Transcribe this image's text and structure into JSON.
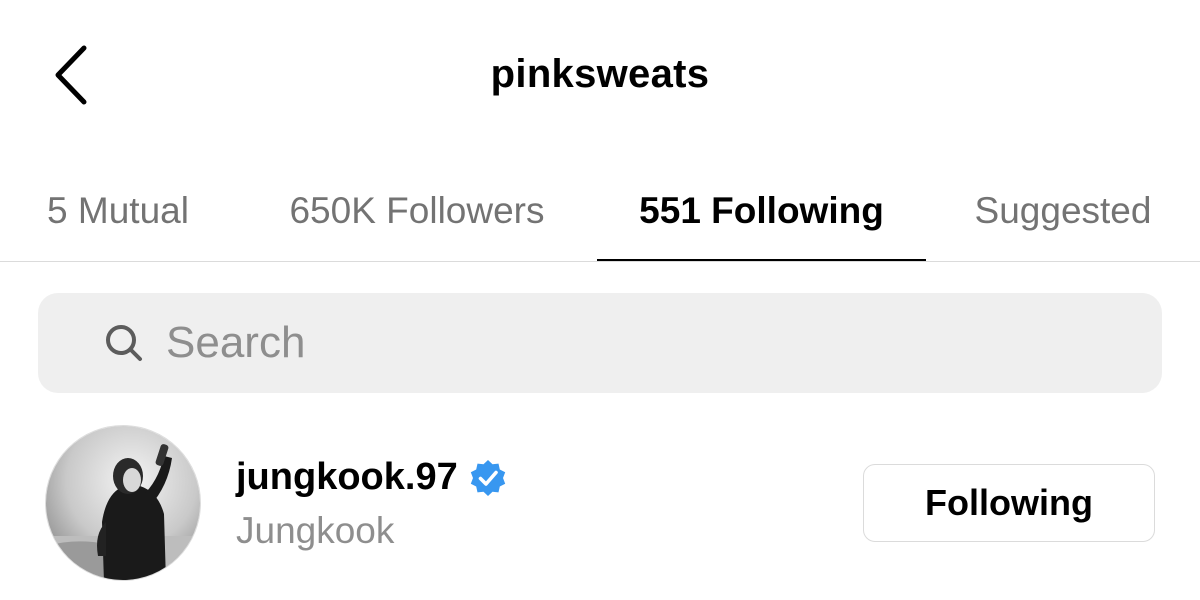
{
  "header": {
    "back_icon": "chevron-left-icon",
    "title": "pinksweats"
  },
  "tabs": [
    {
      "label": "5 Mutual",
      "active": false
    },
    {
      "label": "650K Followers",
      "active": false
    },
    {
      "label": "551 Following",
      "active": true
    },
    {
      "label": "Suggested",
      "active": false
    }
  ],
  "search": {
    "icon": "search-icon",
    "placeholder": "Search",
    "value": ""
  },
  "list": [
    {
      "username": "jungkook.97",
      "verified": true,
      "full_name": "Jungkook",
      "button_label": "Following",
      "verified_color": "#3897f0"
    }
  ]
}
